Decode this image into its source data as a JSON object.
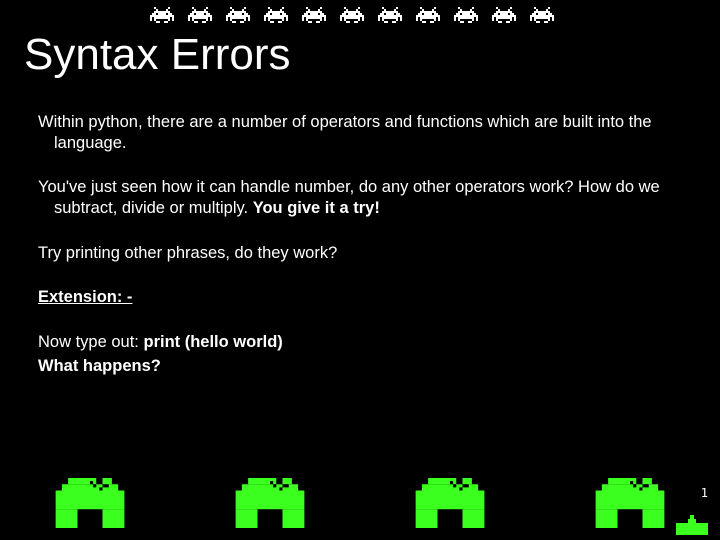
{
  "title": "Syntax Errors",
  "para1": "Within python, there are a number of operators and functions which are built into the language.",
  "para2_a": "You've just seen how it can handle number, do any other operators work? How do we subtract, divide or multiply. ",
  "para2_b": "You give it a try!",
  "para3": "Try printing other phrases, do they work?",
  "extension": "Extension: -",
  "line1_a": "Now type out: ",
  "line1_b": "print (hello world)",
  "line2": "What happens?",
  "lives": "1",
  "invader_count": 11,
  "shield_count": 4
}
